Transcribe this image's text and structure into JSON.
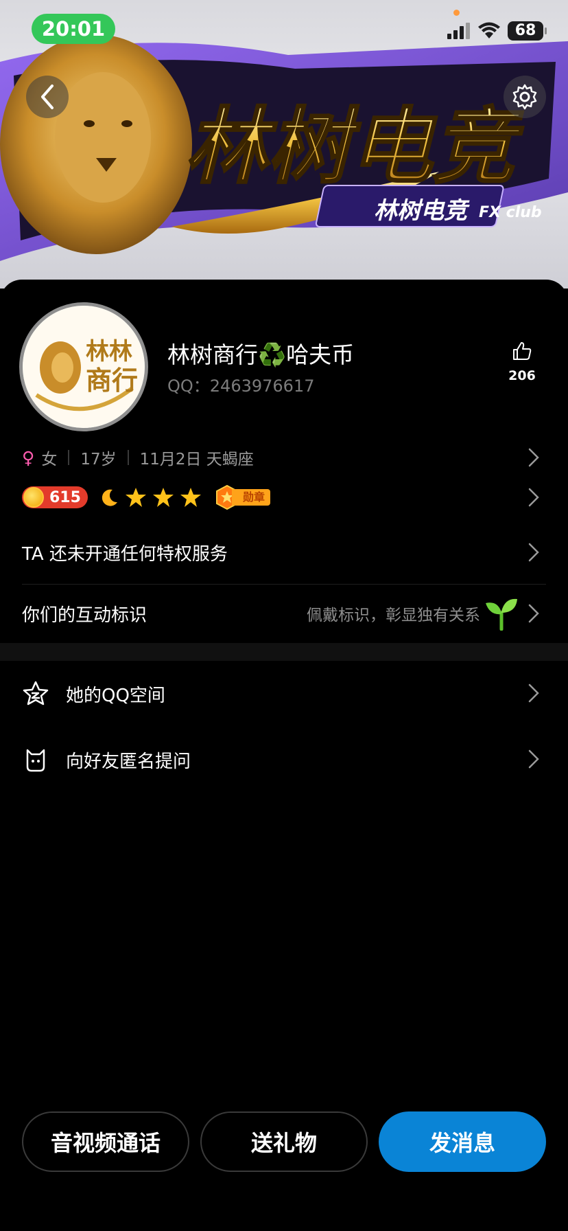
{
  "status_bar": {
    "time": "20:01",
    "battery": "68"
  },
  "banner": {
    "title": "林树电竞",
    "subtitle": "林树电竞",
    "club": "FX club"
  },
  "profile": {
    "name": "林树商行♻️哈夫币",
    "qq_label": "QQ：",
    "qq_number": "2463976617",
    "likes": "206",
    "avatar_text": "林林商行"
  },
  "info": {
    "gender": "女",
    "age": "17岁",
    "birthday": "11月2日 天蝎座"
  },
  "level": {
    "points": "615",
    "medal_label": "勋章"
  },
  "privilege": {
    "label": "TA 还未开通任何特权服务"
  },
  "interaction": {
    "label": "你们的互动标识",
    "hint": "佩戴标识，彰显独有关系"
  },
  "menu": [
    {
      "label": "她的QQ空间"
    },
    {
      "label": "向好友匿名提问"
    }
  ],
  "actions": {
    "call": "音视频通话",
    "gift": "送礼物",
    "message": "发消息"
  },
  "colors": {
    "accent": "#0a84d6",
    "status_green": "#34c759",
    "coin_red": "#e33b2b",
    "gender_pink": "#ff5cb0"
  }
}
